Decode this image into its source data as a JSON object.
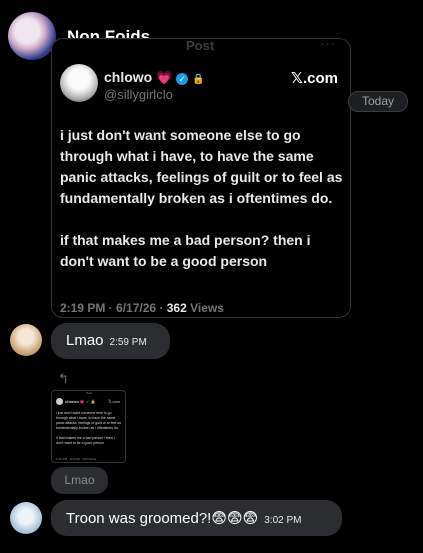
{
  "group": {
    "name": "Non Foids"
  },
  "embed": {
    "title": "Post",
    "more": "···",
    "author_name": "chlowo",
    "author_emoji": "💗",
    "verified_mark": "✓",
    "lock_icon": "🔒",
    "handle": "@sillygirlclo",
    "source": "𝕏.com",
    "text": "i just don't want someone else to go through what i have, to have the same panic attacks, feelings of guilt or to feel as fundamentally broken as i oftentimes do.\n\nif that makes me a bad person? then i don't want to be a good person",
    "timestamp": "2:19 PM · 6/17/26 · ",
    "views_count": "362",
    "views_label": " Views"
  },
  "date_separator": "Today",
  "messages": [
    {
      "text": "Lmao",
      "time": "2:59 PM"
    },
    {
      "text": "Troon was groomed?!😨😨😨",
      "time": "3:02 PM"
    }
  ],
  "reply_preview": {
    "reply_icon": "↰",
    "thumbnail": {
      "title": "Post",
      "author": "chlowo 💗 ✓ 🔒",
      "source": "𝕏.com",
      "text": "i just don't want someone else to go through what i have, to have the same panic attacks, feelings of guilt or to feel as fundamentally broken as i oftentimes do.\n\nif that makes me a bad person? then i don't want to be a good person",
      "meta": "2:19 PM · 6/17/26 · 362 Views"
    },
    "quoted_text": "Lmao"
  }
}
